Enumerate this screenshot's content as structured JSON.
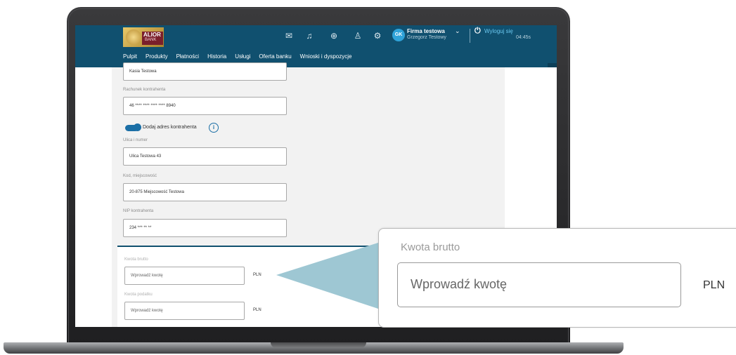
{
  "header": {
    "logo": {
      "text": "ALIOR",
      "sub": "BANK"
    },
    "icons": [
      "messages-icon",
      "bell-icon",
      "download-icon",
      "user-icon",
      "settings-icon"
    ],
    "avatar_initials": "GK",
    "company": "Firma testowa",
    "user": "Grzegorz Testowy",
    "logout_label": "Wyloguj się",
    "session_timer": "04:45s",
    "nav": [
      "Pulpit",
      "Produkty",
      "Płatności",
      "Historia",
      "Usługi",
      "Oferta banku",
      "Wnioski i dyspozycje"
    ]
  },
  "form": {
    "name_value": "Kasia Testowa",
    "account_label": "Rachunek kontrahenta",
    "account_value": "46 **** **** **** **** 8940",
    "address_toggle_label": "Dodaj adres kontrahenta",
    "street_label": "Ulica i numer",
    "street_value": "Ulica Testowa 43",
    "postal_label": "Kod, miejscowość",
    "postal_value": "20-875 Miejscowość Testowa",
    "nip_label": "NIP kontrahenta",
    "nip_value": "234 *** ** **",
    "gross_label": "Kwota brutto",
    "gross_placeholder": "Wprowadź kwotę",
    "tax_label": "Kwota podatku",
    "tax_placeholder": "Wprowadź kwotę",
    "currency": "PLN"
  },
  "zoom": {
    "label": "Kwota brutto",
    "placeholder": "Wprowadź kwotę",
    "currency": "PLN"
  },
  "colors": {
    "header_bg": "#10506f",
    "accent": "#1b6fa6",
    "pointer": "#9ec7d3"
  }
}
